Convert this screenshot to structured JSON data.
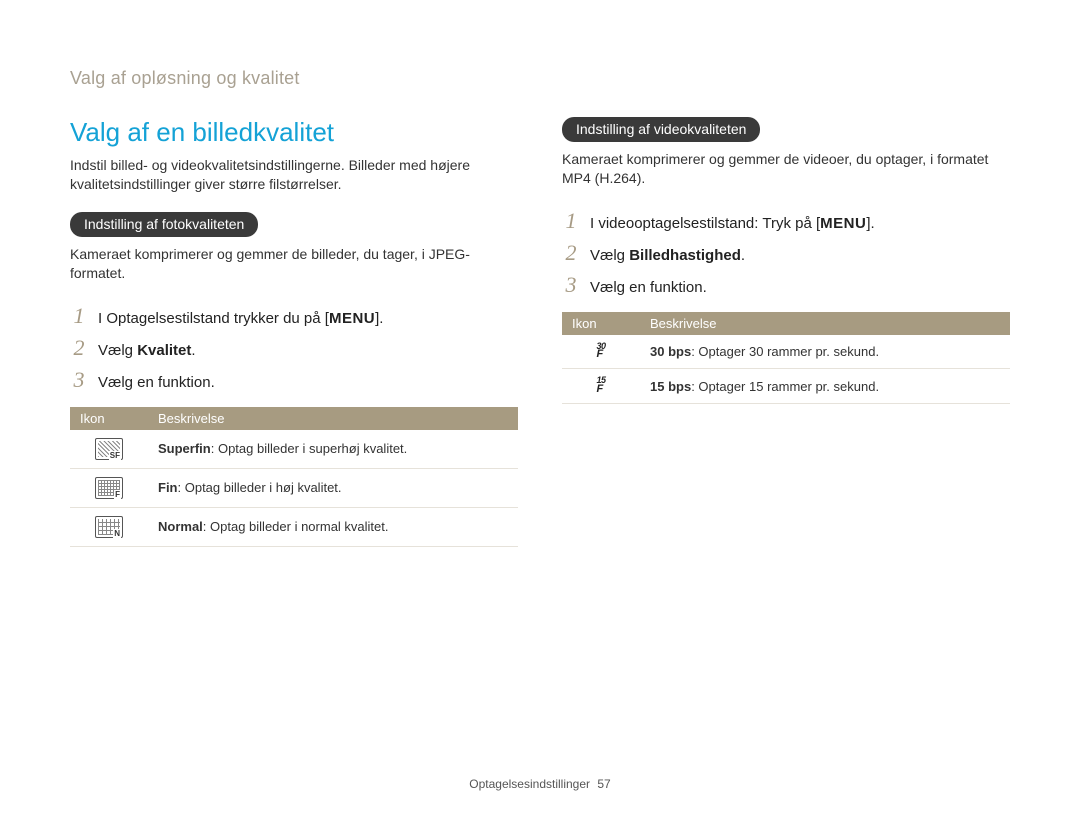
{
  "breadcrumb": "Valg af opløsning og kvalitet",
  "left": {
    "title": "Valg af en billedkvalitet",
    "intro": "Indstil billed- og videokvalitetsindstillingerne. Billeder med højere kvalitetsindstillinger giver større filstørrelser.",
    "pill": "Indstilling af fotokvaliteten",
    "subtext": "Kameraet komprimerer og gemmer de billeder, du tager, i JPEG-formatet.",
    "steps": [
      {
        "num": "1",
        "pre": "I Optagelsestilstand trykker du på [",
        "menu": "MENU",
        "post": "]."
      },
      {
        "num": "2",
        "pre": "Vælg ",
        "bold": "Kvalitet",
        "post": "."
      },
      {
        "num": "3",
        "pre": "Vælg en funktion."
      }
    ],
    "table": {
      "h1": "Ikon",
      "h2": "Beskrivelse",
      "rows": [
        {
          "b": "Superfin",
          "t": ": Optag billeder i superhøj kvalitet."
        },
        {
          "b": "Fin",
          "t": ": Optag billeder i høj kvalitet."
        },
        {
          "b": "Normal",
          "t": ": Optag billeder i normal kvalitet."
        }
      ]
    }
  },
  "right": {
    "pill": "Indstilling af videokvaliteten",
    "subtext": "Kameraet komprimerer og gemmer de videoer, du optager, i formatet MP4 (H.264).",
    "steps": [
      {
        "num": "1",
        "pre": "I videooptagelsestilstand: Tryk på [",
        "menu": "MENU",
        "post": "]."
      },
      {
        "num": "2",
        "pre": "Vælg ",
        "bold": "Billedhastighed",
        "post": "."
      },
      {
        "num": "3",
        "pre": "Vælg en funktion."
      }
    ],
    "table": {
      "h1": "Ikon",
      "h2": "Beskrivelse",
      "rows": [
        {
          "fps": "30",
          "b": "30 bps",
          "t": ": Optager 30 rammer pr. sekund."
        },
        {
          "fps": "15",
          "b": "15 bps",
          "t": ": Optager 15 rammer pr. sekund."
        }
      ]
    }
  },
  "footer": {
    "section": "Optagelsesindstillinger",
    "page": "57"
  }
}
